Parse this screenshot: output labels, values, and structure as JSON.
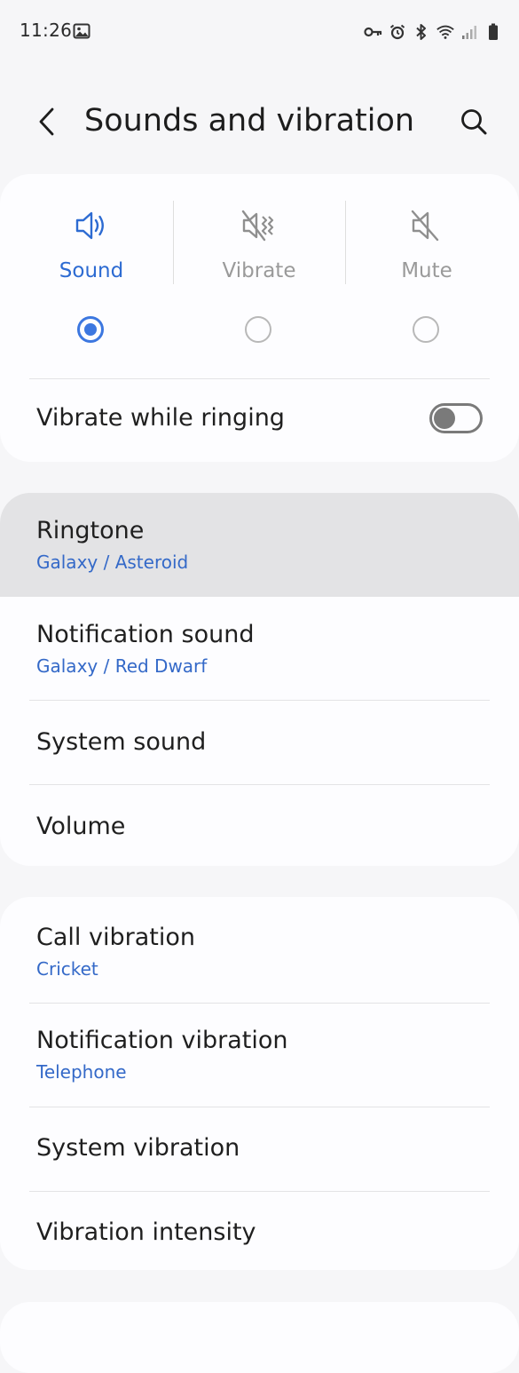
{
  "status_bar": {
    "time": "11:26",
    "left_icons": [
      "image-icon"
    ],
    "right_icons": [
      "vpn-key-icon",
      "alarm-icon",
      "bluetooth-icon",
      "wifi-icon",
      "signal-icon",
      "battery-icon"
    ]
  },
  "header": {
    "title": "Sounds and vibration",
    "back_icon": "chevron-left-icon",
    "search_icon": "search-icon"
  },
  "sound_mode": {
    "options": [
      {
        "label": "Sound",
        "icon": "speaker-icon",
        "selected": true
      },
      {
        "label": "Vibrate",
        "icon": "vibrate-icon",
        "selected": false
      },
      {
        "label": "Mute",
        "icon": "mute-icon",
        "selected": false
      }
    ],
    "vibrate_while_ringing": {
      "label": "Vibrate while ringing",
      "enabled": false
    }
  },
  "sounds": {
    "items": [
      {
        "title": "Ringtone",
        "subtitle": "Galaxy / Asteroid"
      },
      {
        "title": "Notification sound",
        "subtitle": "Galaxy / Red Dwarf"
      },
      {
        "title": "System sound"
      },
      {
        "title": "Volume"
      }
    ]
  },
  "vibration": {
    "items": [
      {
        "title": "Call vibration",
        "subtitle": "Cricket"
      },
      {
        "title": "Notification vibration",
        "subtitle": "Telephone"
      },
      {
        "title": "System vibration"
      },
      {
        "title": "Vibration intensity"
      }
    ]
  },
  "colors": {
    "accent": "#3c77e0",
    "subtitle": "#3469c8",
    "background": "#f6f6f8",
    "card": "#fdfdff",
    "highlight": "#e3e3e5"
  }
}
